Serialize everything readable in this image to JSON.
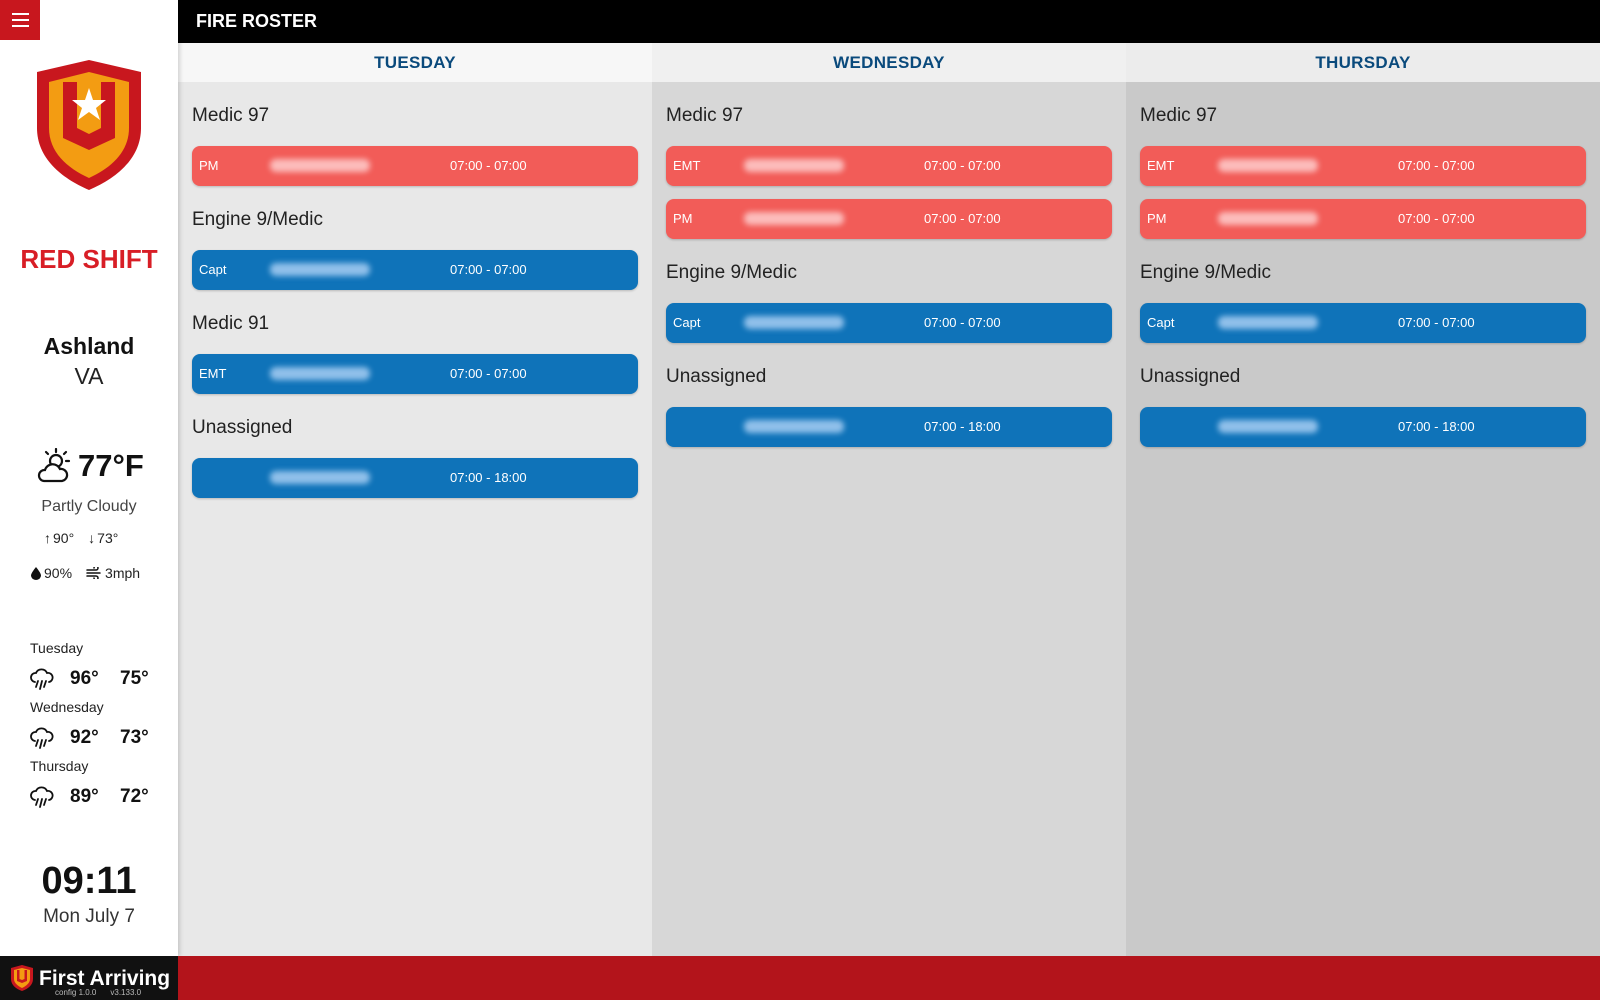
{
  "app": {
    "title": "FIRE ROSTER",
    "brand": "First Arriving",
    "config_version": "config 1.0.0",
    "app_version": "v3.133.0"
  },
  "sidebar": {
    "shift": "RED SHIFT",
    "city": "Ashland",
    "state": "VA",
    "weather": {
      "temp": "77°F",
      "condition": "Partly Cloudy",
      "high": "90°",
      "low": "73°",
      "humidity": "90%",
      "wind": "3mph",
      "icon": "partly-cloudy-icon"
    },
    "forecast": [
      {
        "day": "Tuesday",
        "hi": "96°",
        "lo": "75°",
        "icon": "rain-cloud-icon"
      },
      {
        "day": "Wednesday",
        "hi": "92°",
        "lo": "73°",
        "icon": "rain-cloud-icon"
      },
      {
        "day": "Thursday",
        "hi": "89°",
        "lo": "72°",
        "icon": "rain-cloud-icon"
      }
    ],
    "clock": "09:11",
    "date": "Mon July 7"
  },
  "columns": [
    {
      "day": "TUESDAY",
      "groups": [
        {
          "title": "Medic 97",
          "shifts": [
            {
              "role": "PM",
              "time": "07:00 - 07:00",
              "color": "red"
            }
          ]
        },
        {
          "title": "Engine 9/Medic",
          "shifts": [
            {
              "role": "Capt",
              "time": "07:00 - 07:00",
              "color": "blue"
            }
          ]
        },
        {
          "title": "Medic 91",
          "shifts": [
            {
              "role": "EMT",
              "time": "07:00 - 07:00",
              "color": "blue"
            }
          ]
        },
        {
          "title": "Unassigned",
          "shifts": [
            {
              "role": "",
              "time": "07:00 - 18:00",
              "color": "blue"
            }
          ]
        }
      ]
    },
    {
      "day": "WEDNESDAY",
      "groups": [
        {
          "title": "Medic 97",
          "shifts": [
            {
              "role": "EMT",
              "time": "07:00 - 07:00",
              "color": "red"
            },
            {
              "role": "PM",
              "time": "07:00 - 07:00",
              "color": "red"
            }
          ]
        },
        {
          "title": "Engine 9/Medic",
          "shifts": [
            {
              "role": "Capt",
              "time": "07:00 - 07:00",
              "color": "blue"
            }
          ]
        },
        {
          "title": "Unassigned",
          "shifts": [
            {
              "role": "",
              "time": "07:00 - 18:00",
              "color": "blue"
            }
          ]
        }
      ]
    },
    {
      "day": "THURSDAY",
      "groups": [
        {
          "title": "Medic 97",
          "shifts": [
            {
              "role": "EMT",
              "time": "07:00 - 07:00",
              "color": "red"
            },
            {
              "role": "PM",
              "time": "07:00 - 07:00",
              "color": "red"
            }
          ]
        },
        {
          "title": "Engine 9/Medic",
          "shifts": [
            {
              "role": "Capt",
              "time": "07:00 - 07:00",
              "color": "blue"
            }
          ]
        },
        {
          "title": "Unassigned",
          "shifts": [
            {
              "role": "",
              "time": "07:00 - 18:00",
              "color": "blue"
            }
          ]
        }
      ]
    }
  ],
  "colors": {
    "red_shift": "#d81e26",
    "card_red": "#f25c58",
    "card_blue": "#0f73b9",
    "day_header": "#0a4a7c",
    "footer": "#b3141b"
  }
}
